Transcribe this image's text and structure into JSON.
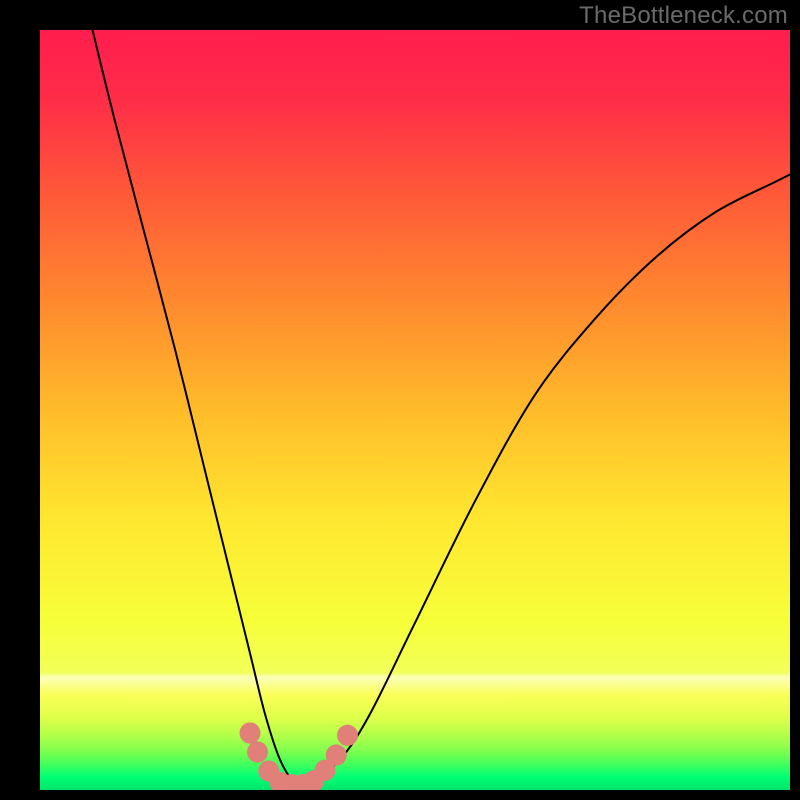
{
  "watermark": {
    "text": "TheBottleneck.com"
  },
  "chart_data": {
    "type": "line",
    "title": "",
    "xlabel": "",
    "ylabel": "",
    "xlim": [
      0,
      100
    ],
    "ylim": [
      0,
      100
    ],
    "grid": false,
    "series": [
      {
        "name": "bottleneck-curve",
        "x": [
          7,
          10,
          14,
          18,
          22,
          25,
          28,
          30,
          32,
          34,
          36,
          40,
          44,
          50,
          58,
          66,
          74,
          82,
          90,
          98,
          100
        ],
        "y": [
          100,
          88,
          73,
          58,
          42,
          30,
          18,
          10,
          4,
          1,
          1,
          4,
          10,
          22,
          38,
          52,
          62,
          70,
          76,
          80,
          81
        ]
      }
    ],
    "markers": {
      "name": "highlight-dots",
      "color": "#e08078",
      "x": [
        28,
        29,
        30.5,
        32,
        33.5,
        35,
        36.5,
        38,
        39.5,
        41
      ],
      "y": [
        7.5,
        5,
        2.5,
        1,
        0.7,
        0.7,
        1.2,
        2.6,
        4.6,
        7.2
      ]
    },
    "background_gradient": {
      "stops": [
        {
          "offset": 0.0,
          "color": "#ff1e4e"
        },
        {
          "offset": 0.09,
          "color": "#ff2c48"
        },
        {
          "offset": 0.22,
          "color": "#ff5a38"
        },
        {
          "offset": 0.36,
          "color": "#ff8a2e"
        },
        {
          "offset": 0.5,
          "color": "#ffbb2a"
        },
        {
          "offset": 0.64,
          "color": "#ffe62f"
        },
        {
          "offset": 0.78,
          "color": "#f6ff3a"
        },
        {
          "offset": 0.845,
          "color": "#f2ff58"
        },
        {
          "offset": 0.852,
          "color": "#fbffb8"
        },
        {
          "offset": 0.875,
          "color": "#faff57"
        },
        {
          "offset": 0.905,
          "color": "#dfff4a"
        },
        {
          "offset": 0.928,
          "color": "#b3ff49"
        },
        {
          "offset": 0.948,
          "color": "#80ff4e"
        },
        {
          "offset": 0.965,
          "color": "#46ff5b"
        },
        {
          "offset": 0.983,
          "color": "#00ff74"
        },
        {
          "offset": 1.0,
          "color": "#00e56a"
        }
      ]
    }
  }
}
